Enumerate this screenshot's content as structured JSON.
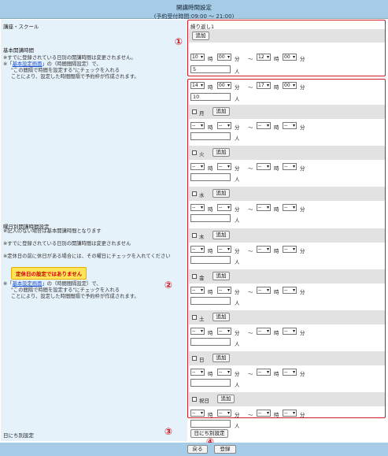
{
  "header": {
    "title": "開講時間設定",
    "subtitle": "(予約受付時間:09:00 〜 21:00)"
  },
  "left": {
    "course_label": "講座・スクール",
    "basic_label": "基本開講時間",
    "basic_note1": "※すでに登録されている日別の開講時間は変更されません。",
    "basic_note2_pre": "※「",
    "basic_note2_link": "基本設定画面",
    "basic_note2_post": "」の（時間間隔設定）で、",
    "basic_note3": "\"この間隔で時間を設定する\"にチェックを入れる",
    "basic_note4": "ことにより、設定した時間間隔で予約枠が作成されます。",
    "weekday_label": "曜日別開講時間設定",
    "weekday_note1": "※記入のない場合は基本開講時間となります",
    "weekday_note2": "※すでに登録されている日別の開講時間は変更されません",
    "weekday_note3": "※定休日の前に休日がある場合には、その曜日にチェックを入れてください",
    "warning": "定休日の設定ではありません",
    "weekday_note4_pre": "※「",
    "weekday_note4_link": "基本設定画面",
    "weekday_note4_post": "」の（時間間隔設定）で、",
    "weekday_note5": "\"この間隔で時間を設定する\"にチェックを入れる",
    "weekday_note6": "ことにより、設定した時間間隔で予約枠が作成されます。",
    "daily_label": "日にち別設定"
  },
  "course": {
    "name": "繰り返し1",
    "add": "追加"
  },
  "basic": {
    "start_h": "10",
    "start_m": "00",
    "end_h": "12",
    "end_m": "00",
    "capacity": "5"
  },
  "default_row": {
    "start_h": "14",
    "start_m": "00",
    "end_h": "17",
    "end_m": "00",
    "capacity": "10"
  },
  "units": {
    "hour": "時",
    "minute": "分",
    "tilde": "〜",
    "person": "人",
    "dash": "--"
  },
  "days": [
    {
      "label": "月",
      "add": "追加"
    },
    {
      "label": "火",
      "add": "追加"
    },
    {
      "label": "水",
      "add": "追加"
    },
    {
      "label": "木",
      "add": "追加"
    },
    {
      "label": "金",
      "add": "追加"
    },
    {
      "label": "土",
      "add": "追加"
    },
    {
      "label": "日",
      "add": "追加"
    },
    {
      "label": "祝日",
      "add": "追加"
    }
  ],
  "daily_button": "日にち別設定",
  "footer": {
    "back": "戻る",
    "register": "登録"
  },
  "markers": [
    "①",
    "②",
    "③",
    "④"
  ],
  "colors": {
    "header": "#a6cbe6",
    "left_bg": "#e6f2fa",
    "red": "#d01b26",
    "warn_bg": "#ffe45a"
  }
}
